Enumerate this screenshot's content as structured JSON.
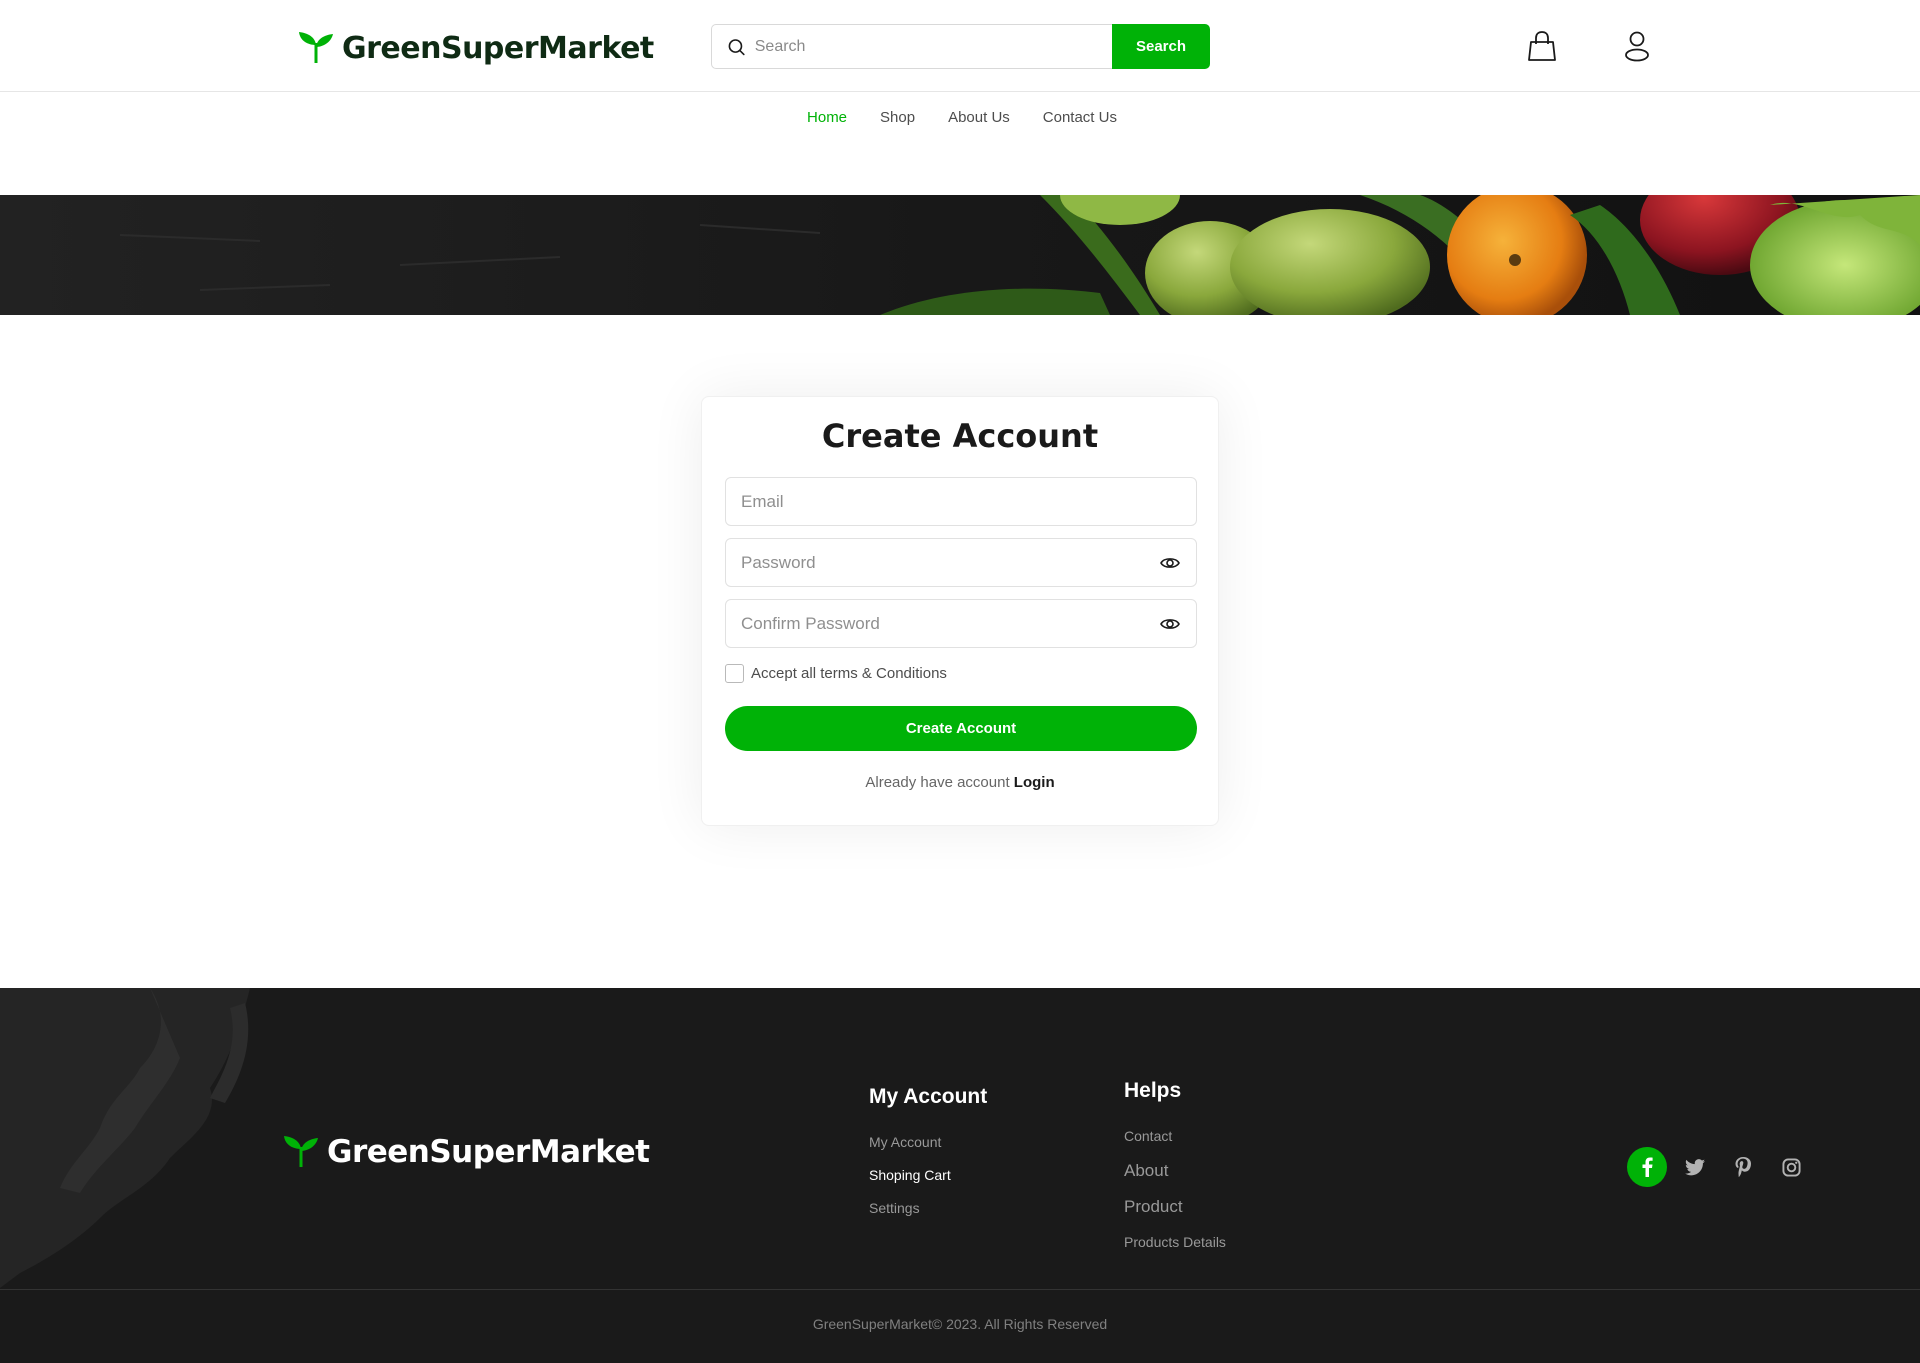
{
  "brand": {
    "name": "GreenSuperMarket",
    "accent": "#00b207"
  },
  "header": {
    "search_placeholder": "Search",
    "search_button": "Search",
    "cart_icon": "shopping-bag-icon",
    "account_icon": "user-icon"
  },
  "nav": {
    "items": [
      {
        "label": "Home",
        "active": true
      },
      {
        "label": "Shop",
        "active": false
      },
      {
        "label": "About Us",
        "active": false
      },
      {
        "label": "Contact Us",
        "active": false
      }
    ]
  },
  "form": {
    "title": "Create Account",
    "email_placeholder": "Email",
    "password_placeholder": "Password",
    "confirm_placeholder": "Confirm Password",
    "terms_label": "Accept all terms & Conditions",
    "submit_label": "Create Account",
    "login_prompt": "Already have account",
    "login_link": "Login"
  },
  "footer": {
    "brand": "GreenSuperMarket",
    "my_account": {
      "title": "My Account",
      "links": [
        "My Account",
        "Shoping Cart",
        "Settings"
      ]
    },
    "helps": {
      "title": "Helps",
      "links": [
        "Contact",
        "About",
        "Product",
        "Products Details"
      ]
    },
    "social": [
      "facebook-icon",
      "twitter-icon",
      "pinterest-icon",
      "instagram-icon"
    ],
    "copyright": "GreenSuperMarket© 2023. All Rights Reserved"
  }
}
